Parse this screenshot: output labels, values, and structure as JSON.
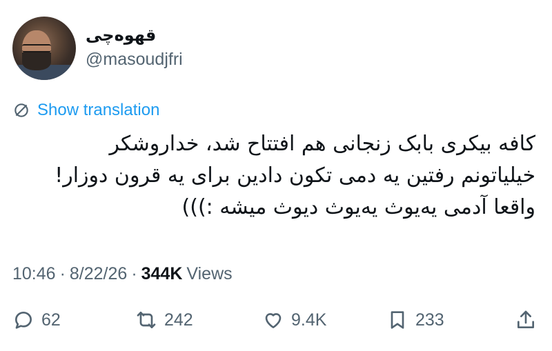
{
  "user": {
    "display_name": "قهوه‌چی",
    "handle": "@masoudjfri"
  },
  "translation": {
    "label": "Show translation"
  },
  "tweet": {
    "lines": [
      "کافه بیکری بابک زنجانی هم افتتاح شد، خداروشکر",
      "خیلیاتونم رفتین یه دمی تکون دادین برای یه قرون دوزار!",
      "واقعا آدمی یه‌یوث یه‌یوث دیوث میشه :)))"
    ]
  },
  "meta": {
    "time": "10:46",
    "date": "8/22/26",
    "views_count": "344K",
    "views_label": "Views"
  },
  "actions": {
    "replies": "62",
    "retweets": "242",
    "likes": "9.4K",
    "bookmarks": "233"
  },
  "icons": {
    "translate": "translate-icon",
    "reply": "reply-icon",
    "retweet": "retweet-icon",
    "like": "heart-icon",
    "bookmark": "bookmark-icon",
    "share": "share-icon"
  },
  "colors": {
    "link": "#1d9bf0",
    "secondary_text": "#536471",
    "primary_text": "#0f1419"
  }
}
